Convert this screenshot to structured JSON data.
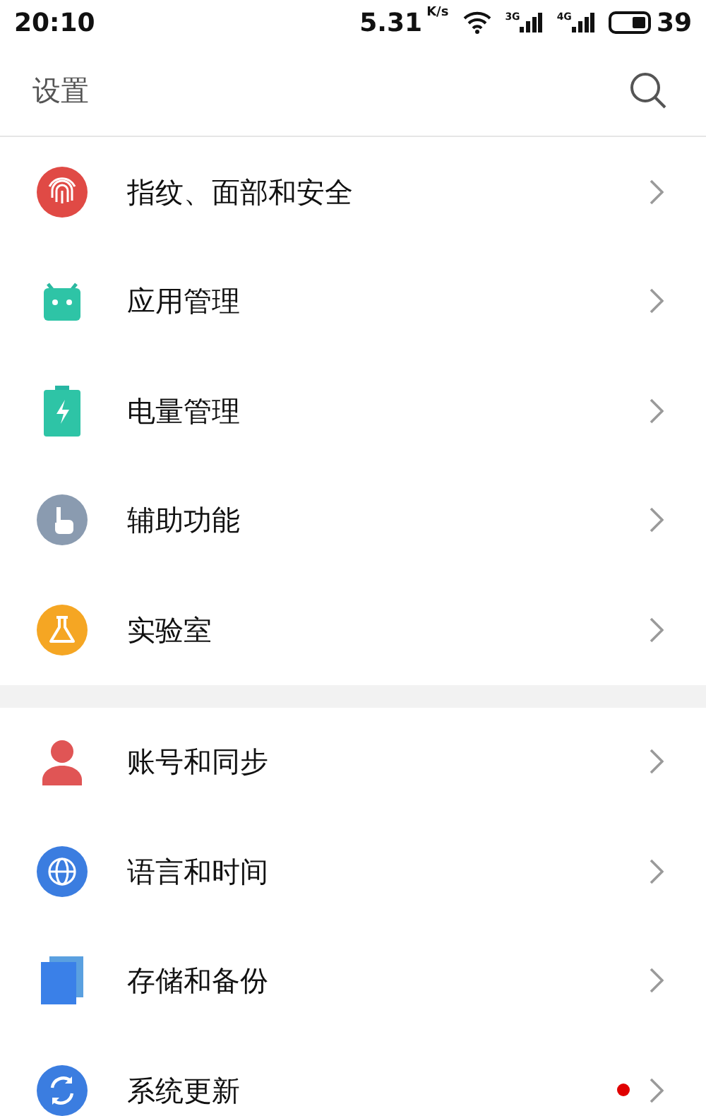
{
  "status_bar": {
    "time": "20:10",
    "speed": "5.31",
    "speed_unit": "K/s",
    "signals": [
      "3G",
      "4G"
    ],
    "battery": "39"
  },
  "header": {
    "title": "设置"
  },
  "groups": [
    {
      "items": [
        {
          "label": "指纹、面部和安全",
          "kind": "fingerprint",
          "badge": false
        },
        {
          "label": "应用管理",
          "kind": "android",
          "badge": false
        },
        {
          "label": "电量管理",
          "kind": "battery",
          "badge": false
        },
        {
          "label": "辅助功能",
          "kind": "hand",
          "badge": false
        },
        {
          "label": "实验室",
          "kind": "flask",
          "badge": false
        }
      ]
    },
    {
      "items": [
        {
          "label": "账号和同步",
          "kind": "person",
          "badge": false
        },
        {
          "label": "语言和时间",
          "kind": "globe",
          "badge": false
        },
        {
          "label": "存储和备份",
          "kind": "pages",
          "badge": false
        },
        {
          "label": "系统更新",
          "kind": "sync",
          "badge": true
        }
      ]
    }
  ]
}
